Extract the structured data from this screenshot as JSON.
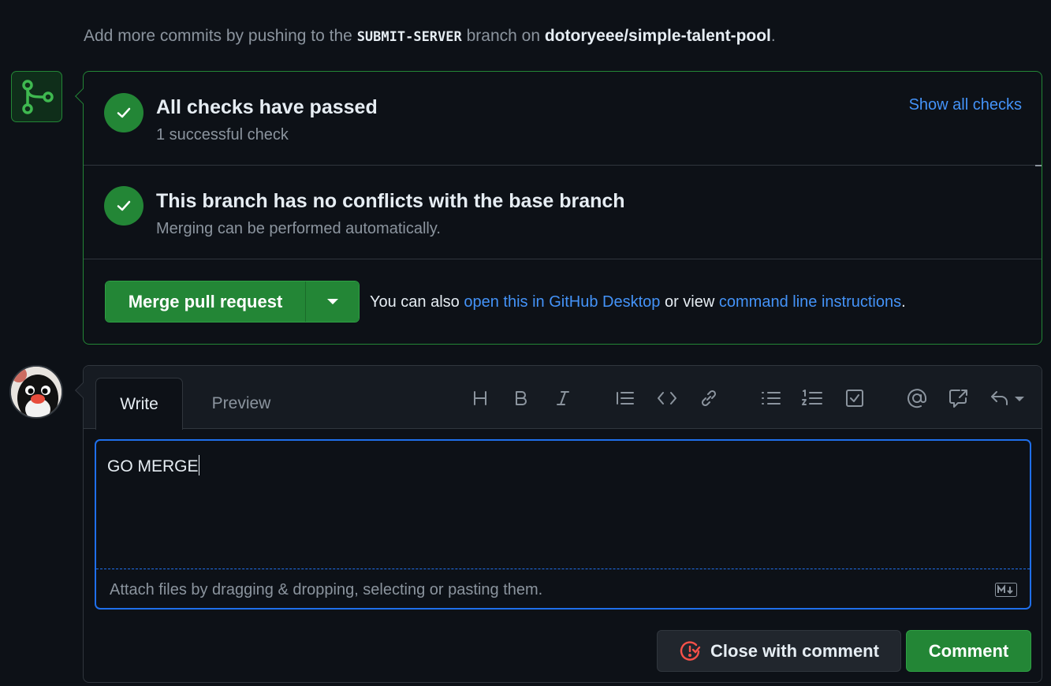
{
  "hint": {
    "prefix": "Add more commits by pushing to the",
    "branch": "SUBMIT-SERVER",
    "middle": "branch on",
    "repo": "dotoryeee/simple-talent-pool",
    "suffix": "."
  },
  "checks": {
    "title": "All checks have passed",
    "subtitle": "1 successful check",
    "show_all": "Show all checks"
  },
  "conflicts": {
    "title": "This branch has no conflicts with the base branch",
    "subtitle": "Merging can be performed automatically."
  },
  "merge": {
    "button_label": "Merge pull request",
    "also_prefix": "You can also",
    "desktop_link": "open this in GitHub Desktop",
    "also_middle": "or view",
    "cli_link": "command line instructions",
    "also_suffix": "."
  },
  "comment": {
    "tabs": [
      {
        "label": "Write",
        "active": true
      },
      {
        "label": "Preview",
        "active": false
      }
    ],
    "text": "GO MERGE",
    "attach_hint": "Attach files by dragging & dropping, selecting or pasting them.",
    "close_label": "Close with comment",
    "comment_label": "Comment"
  },
  "toolbar": [
    "heading-icon",
    "bold-icon",
    "italic-icon",
    "quote-icon",
    "code-icon",
    "link-icon",
    "unordered-list-icon",
    "ordered-list-icon",
    "task-list-icon",
    "mention-icon",
    "cross-reference-icon",
    "saved-replies-icon"
  ],
  "colors": {
    "background": "#0d1117",
    "success": "#238636",
    "link": "#4493f8",
    "focus": "#1f6feb",
    "danger": "#f85149"
  }
}
